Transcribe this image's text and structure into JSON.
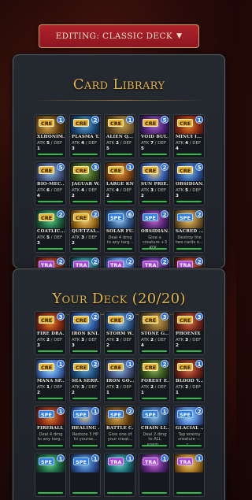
{
  "header": {
    "deck_select_label": "EDITING: CLASSIC DECK",
    "caret": "▼"
  },
  "library": {
    "title": "Card Library",
    "cards": [
      {
        "type": "CRE",
        "cost": "1",
        "name": "XLHONIM...",
        "atk": "5",
        "def": "1",
        "art": "a1"
      },
      {
        "type": "CRE",
        "cost": "2",
        "name": "PLASMA T...",
        "atk": "4",
        "def": "3",
        "art": "a2"
      },
      {
        "type": "CRE",
        "cost": "1",
        "name": "ALIEN Q...",
        "atk": "2",
        "def": "5",
        "art": "a3"
      },
      {
        "type": "CRE",
        "cost": "5",
        "name": "VOID BUI...",
        "atk": "7",
        "def": "5",
        "art": "a4"
      },
      {
        "type": "CRE",
        "cost": "1",
        "name": "MINUI I...",
        "atk": "4",
        "def": "4",
        "art": "a5"
      },
      {
        "type": "CRE",
        "cost": "5",
        "name": "BIO-MEC...",
        "atk": "6",
        "def": "4",
        "art": "a6"
      },
      {
        "type": "CRE",
        "cost": "3",
        "name": "JAGUAR W...",
        "atk": "4",
        "def": "2",
        "art": "a7"
      },
      {
        "type": "CRE",
        "cost": "1",
        "name": "LARGE KN...",
        "atk": "4",
        "def": "2",
        "art": "a8"
      },
      {
        "type": "CRE",
        "cost": "2",
        "name": "SUN PRIE...",
        "atk": "3",
        "def": "2",
        "art": "a9"
      },
      {
        "type": "CRE",
        "cost": "5",
        "name": "OBSIDIAN...",
        "atk": "5",
        "def": "3",
        "art": "a10"
      },
      {
        "type": "CRE",
        "cost": "2",
        "name": "COATLIC...",
        "atk": "5",
        "def": "3",
        "art": "a11"
      },
      {
        "type": "CRE",
        "cost": "2",
        "name": "QUETZAL...",
        "atk": "3",
        "def": "2",
        "art": "a12"
      },
      {
        "type": "SPE",
        "cost": "6",
        "name": "SOLAR FU...",
        "desc": "Deal 4 dmg to any targ...",
        "art": "a13"
      },
      {
        "type": "SPE",
        "cost": "2",
        "name": "OBSIDIAN...",
        "desc": "Give a creature +3 ATK...",
        "art": "a14"
      },
      {
        "type": "SPE",
        "cost": "2",
        "name": "SACRED ...",
        "desc": "Destroy the two cards o...",
        "art": "a15"
      },
      {
        "type": "TRA",
        "cost": "2",
        "name": "",
        "art": "a16"
      },
      {
        "type": "TRA",
        "cost": "2",
        "name": "",
        "art": "a17"
      },
      {
        "type": "TRA",
        "cost": "2",
        "name": "",
        "art": "a18"
      },
      {
        "type": "TRA",
        "cost": "2",
        "name": "",
        "art": "a4"
      },
      {
        "type": "TRA",
        "cost": "2",
        "name": "",
        "art": "a16"
      }
    ]
  },
  "deck": {
    "title": "Your Deck (20/20)",
    "cards": [
      {
        "type": "CRE",
        "cost": "3",
        "name": "FIRE DRA...",
        "atk": "2",
        "def": "3",
        "art": "a5"
      },
      {
        "type": "CRE",
        "cost": "2",
        "name": "IRON KNI...",
        "atk": "3",
        "def": "3",
        "art": "a10"
      },
      {
        "type": "CRE",
        "cost": "2",
        "name": "STORM W...",
        "atk": "3",
        "def": "2",
        "art": "a13"
      },
      {
        "type": "CRE",
        "cost": "3",
        "name": "STONE G...",
        "atk": "2",
        "def": "4",
        "art": "a3"
      },
      {
        "type": "CRE",
        "cost": "3",
        "name": "PHOENIX",
        "atk": "3",
        "def": "2",
        "art": "a16"
      },
      {
        "type": "CRE",
        "cost": "1",
        "name": "MANA SP...",
        "atk": "1",
        "def": "2",
        "art": "a18"
      },
      {
        "type": "CRE",
        "cost": "2",
        "name": "SEA SERP...",
        "atk": "3",
        "def": "2",
        "art": "a2"
      },
      {
        "type": "CRE",
        "cost": "1",
        "name": "IRON GO...",
        "atk": "2",
        "def": "1",
        "art": "a6"
      },
      {
        "type": "CRE",
        "cost": "2",
        "name": "FOREST E...",
        "atk": "2",
        "def": "1",
        "art": "a7"
      },
      {
        "type": "CRE",
        "cost": "1",
        "name": "BLOOD V...",
        "atk": "2",
        "def": "1",
        "art": "a16"
      },
      {
        "type": "SPE",
        "cost": "1",
        "name": "FIREBALL",
        "desc": "Deal 4 dmg to any targ...",
        "art": "a5"
      },
      {
        "type": "SPE",
        "cost": "1",
        "name": "HEALING ...",
        "desc": "Restore 3 HP to yourse...",
        "art": "a9"
      },
      {
        "type": "SPE",
        "cost": "2",
        "name": "BATTLE C...",
        "desc": "Give one of your creat...",
        "art": "a1"
      },
      {
        "type": "SPE",
        "cost": "1",
        "name": "CHAIN LI...",
        "desc": "Deal 2 dmg to ALL enem...",
        "art": "a13"
      },
      {
        "type": "SPE",
        "cost": "2",
        "name": "GLACIAL ...",
        "desc": "Tap enemy creature — c...",
        "art": "a18"
      },
      {
        "type": "SPE",
        "cost": "1",
        "name": "",
        "art": "a11"
      },
      {
        "type": "SPE",
        "cost": "1",
        "name": "",
        "art": "a10"
      },
      {
        "type": "TRA",
        "cost": "1",
        "name": "",
        "art": "a17"
      },
      {
        "type": "TRA",
        "cost": "1",
        "name": "",
        "art": "a14"
      },
      {
        "type": "TRA",
        "cost": "1",
        "name": "",
        "art": "a12"
      }
    ]
  }
}
